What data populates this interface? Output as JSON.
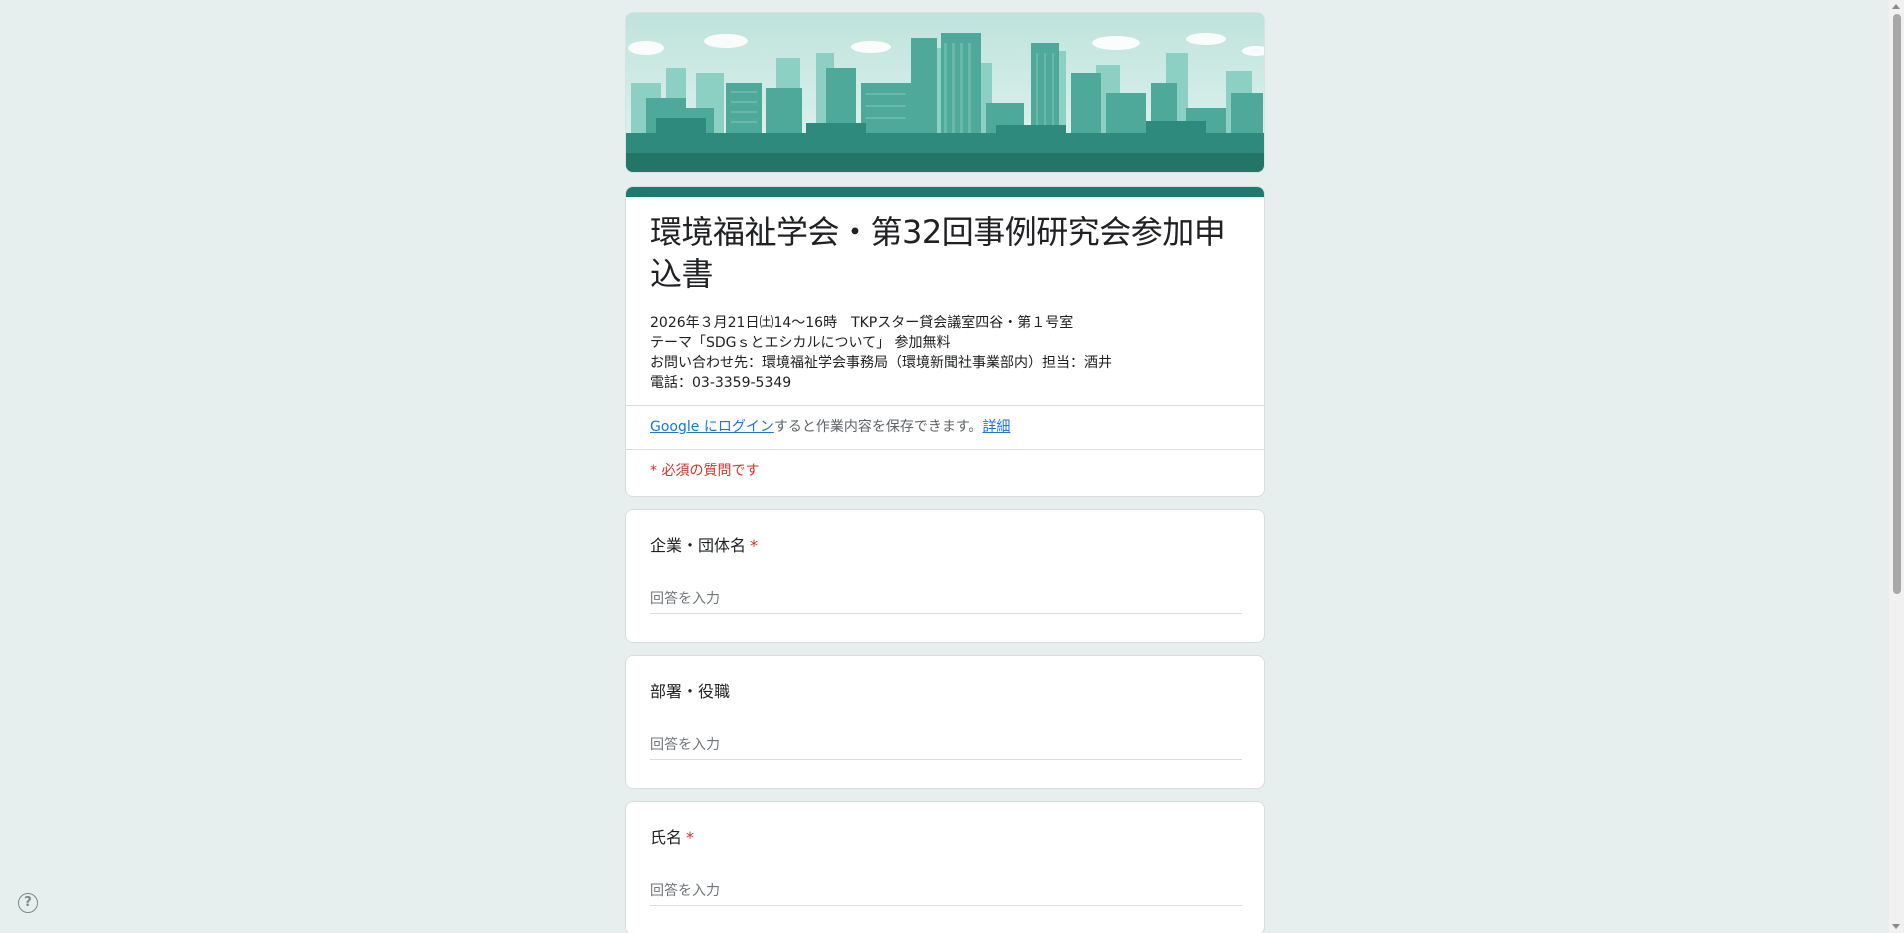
{
  "header": {
    "title": "環境福祉学会・第32回事例研究会参加申込書",
    "description_lines": [
      "2026年３月21日㈯14～16時　TKPスター貸会議室四谷・第１号室",
      "テーマ「SDGｓとエシカルについて」 参加無料",
      "お問い合わせ先：環境福祉学会事務局（環境新聞社事業部内）担当：酒井",
      "電話：03-3359-5349"
    ]
  },
  "login_notice": {
    "login_link": "Google にログイン",
    "middle_text": "すると作業内容を保存できます。",
    "details_link": "詳細"
  },
  "required_notice": "* 必須の質問です",
  "questions": [
    {
      "title": "企業・団体名",
      "required_mark": "*",
      "placeholder": "回答を入力"
    },
    {
      "title": "部署・役職",
      "required_mark": "",
      "placeholder": "回答を入力"
    },
    {
      "title": "氏名",
      "required_mark": "*",
      "placeholder": "回答を入力"
    }
  ],
  "help": {
    "label": "?"
  },
  "colors": {
    "theme": "#1c7a6e",
    "background": "#e6efee",
    "required": "#d93025",
    "link": "#1a73e8"
  }
}
